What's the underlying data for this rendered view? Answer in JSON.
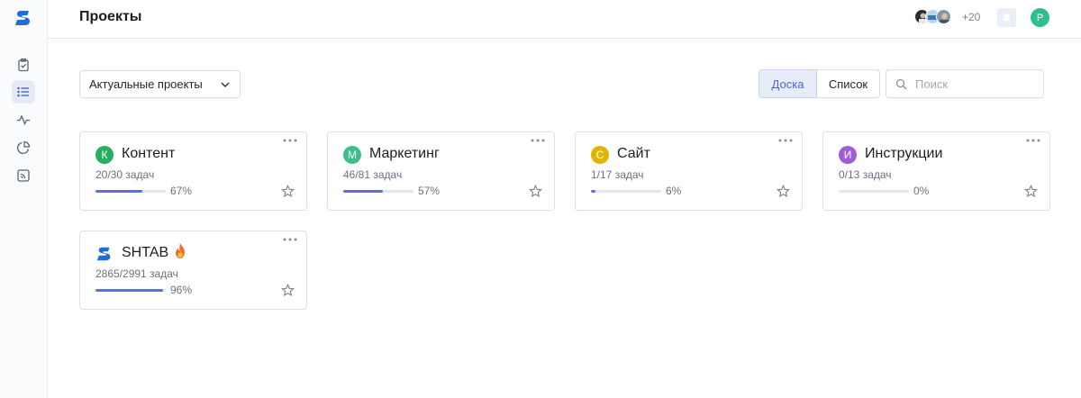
{
  "header": {
    "title": "Проекты",
    "more_members": "+20",
    "user_initial": "P"
  },
  "filter": {
    "selected": "Актуальные проекты"
  },
  "view_toggle": {
    "board": "Доска",
    "list": "Список"
  },
  "search": {
    "placeholder": "Поиск"
  },
  "colors": {
    "accent": "#5b6fe0",
    "user_avatar": "#2fbf8d"
  },
  "projects": [
    {
      "initial": "К",
      "name": "Контент",
      "tasks": "20/30 задач",
      "percent_label": "67%",
      "progress": 0.67,
      "color": "#27ae60"
    },
    {
      "initial": "М",
      "name": "Маркетинг",
      "tasks": "46/81 задач",
      "percent_label": "57%",
      "progress": 0.57,
      "color": "#3cc08a"
    },
    {
      "initial": "С",
      "name": "Сайт",
      "tasks": "1/17 задач",
      "percent_label": "6%",
      "progress": 0.06,
      "color": "#e1b400"
    },
    {
      "initial": "И",
      "name": "Инструкции",
      "tasks": "0/13 задач",
      "percent_label": "0%",
      "progress": 0.0,
      "color": "#a15ad8"
    },
    {
      "initial": "",
      "icon": "shtab-logo-icon",
      "name": "SHTAB",
      "tasks": "2865/2991 задач",
      "percent_label": "96%",
      "progress": 0.96,
      "color": "#1d6fd6"
    }
  ]
}
